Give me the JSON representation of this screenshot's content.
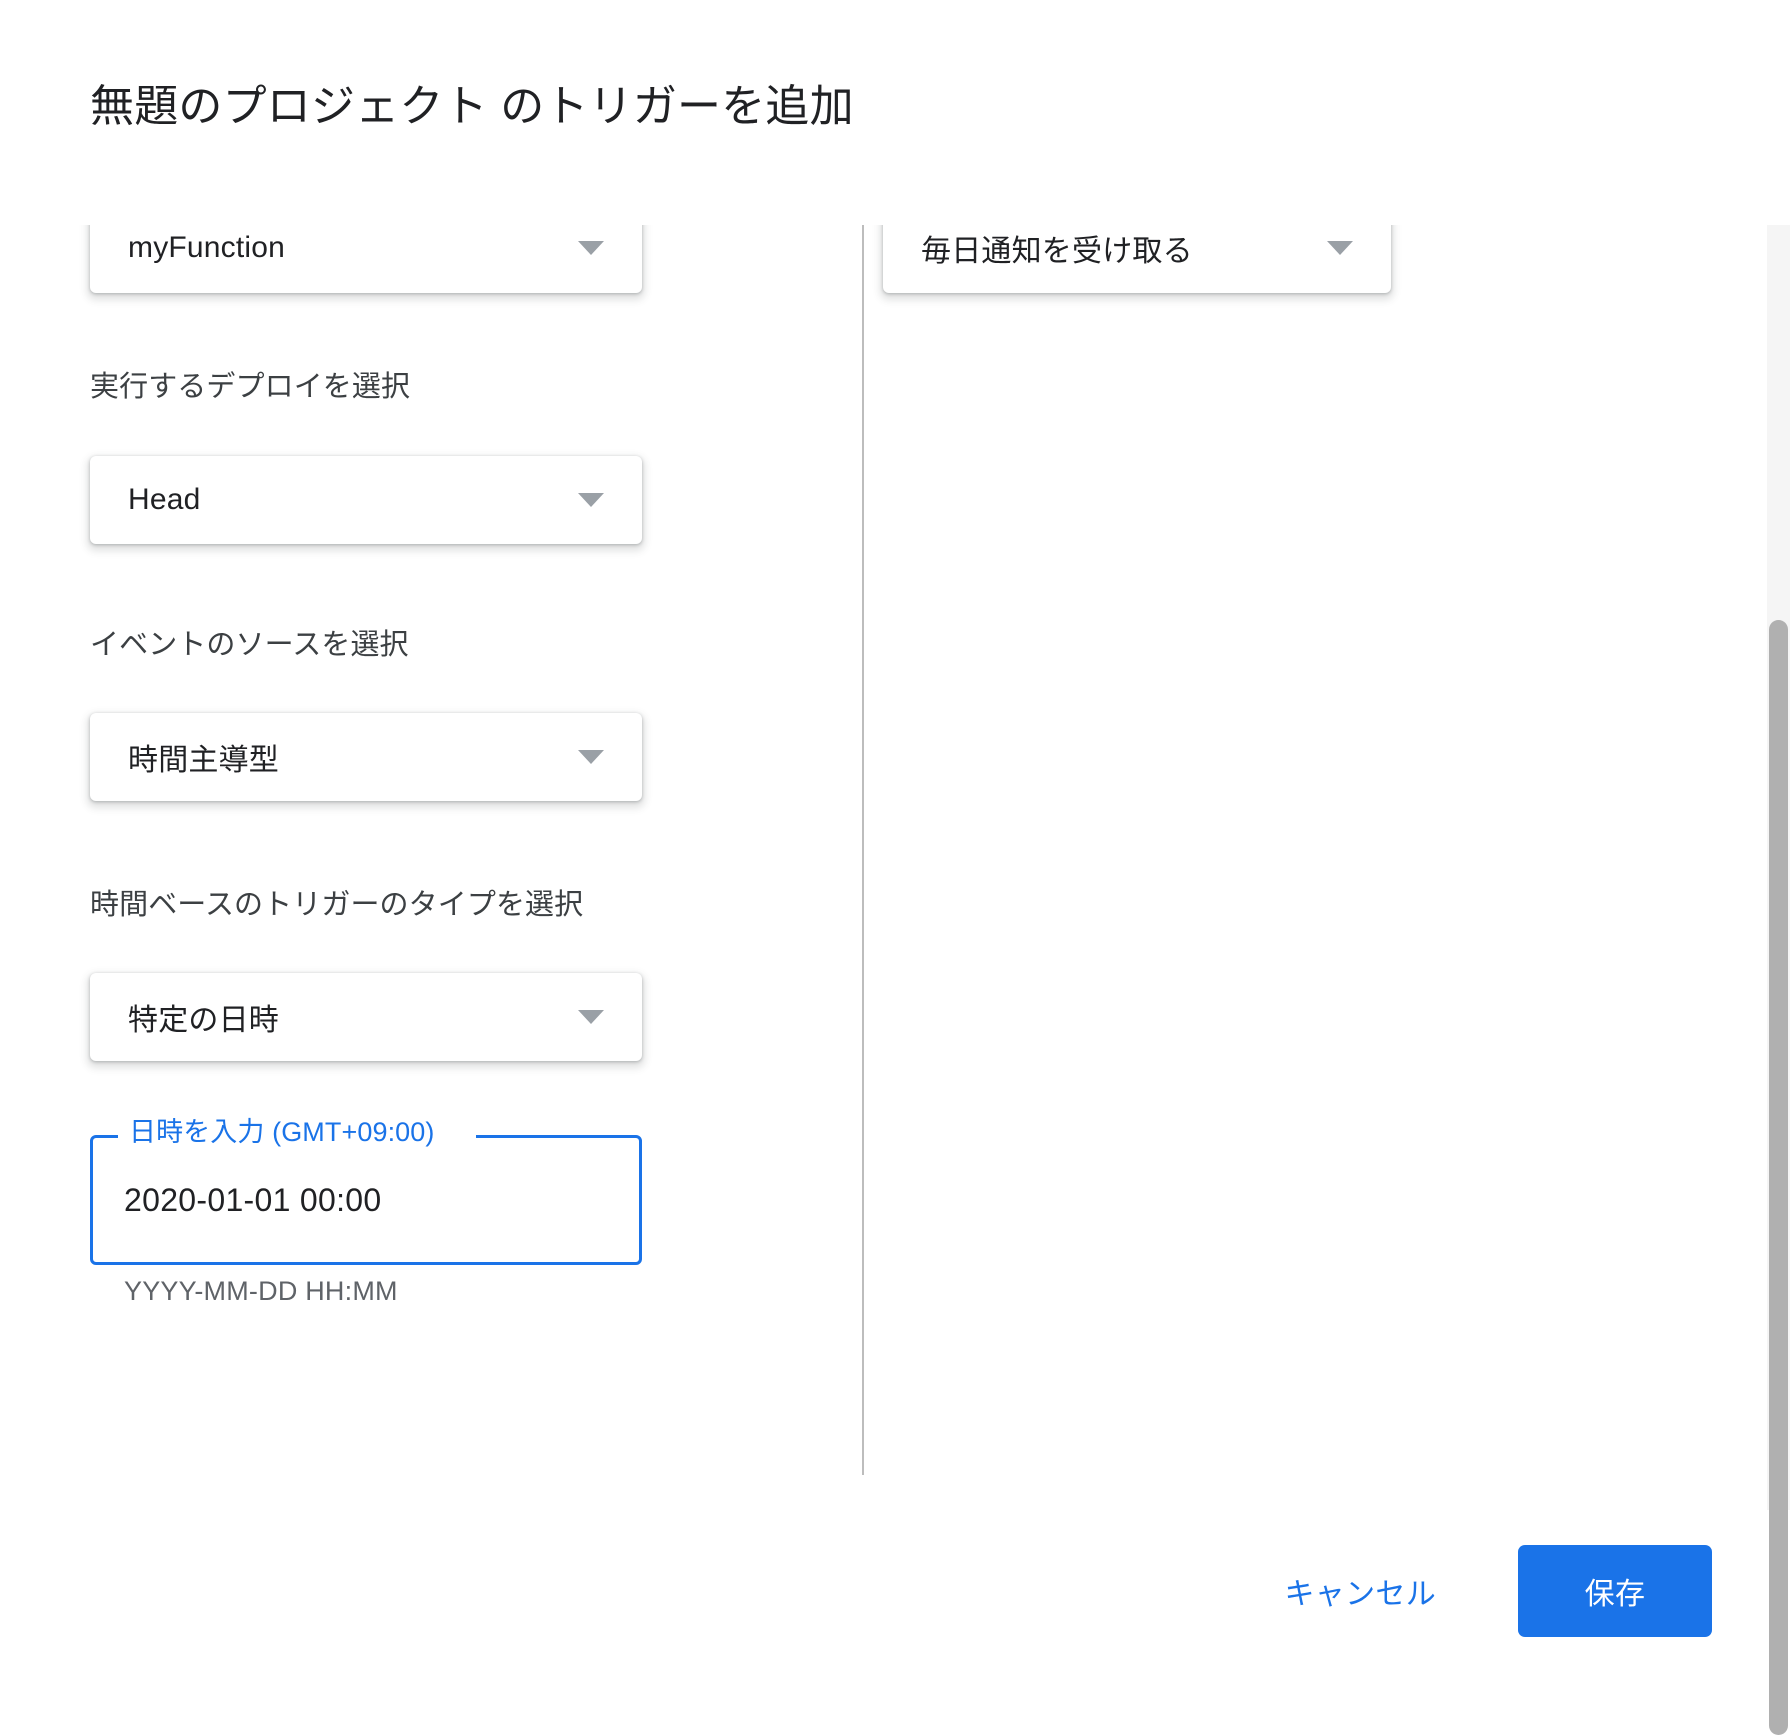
{
  "dialog": {
    "title": "無題のプロジェクト のトリガーを追加"
  },
  "left_column": {
    "function_select": {
      "value": "myFunction",
      "caret_icon": "chevron-down-icon"
    },
    "deploy_label": "実行するデプロイを選択",
    "deploy_select": {
      "value": "Head",
      "caret_icon": "chevron-down-icon"
    },
    "event_source_label": "イベントのソースを選択",
    "event_source_select": {
      "value": "時間主導型",
      "caret_icon": "chevron-down-icon"
    },
    "time_trigger_type_label": "時間ベースのトリガーのタイプを選択",
    "time_trigger_type_select": {
      "value": "特定の日時",
      "caret_icon": "chevron-down-icon"
    },
    "datetime_field": {
      "label": "日時を入力 (GMT+09:00)",
      "value": "2020-01-01 00:00",
      "placeholder": "YYYY-MM-DD HH:MM",
      "hint": "YYYY-MM-DD HH:MM"
    }
  },
  "right_column": {
    "notification_select": {
      "value": "毎日通知を受け取る",
      "caret_icon": "chevron-down-icon"
    }
  },
  "footer": {
    "cancel_label": "キャンセル",
    "save_label": "保存"
  },
  "colors": {
    "accent": "#1a73e8",
    "text_primary": "#202124",
    "text_secondary": "#5f6368",
    "divider": "#bdbdbd",
    "scrollbar_thumb": "#b0b0b0",
    "scrollbar_track": "#f5f5f5"
  }
}
